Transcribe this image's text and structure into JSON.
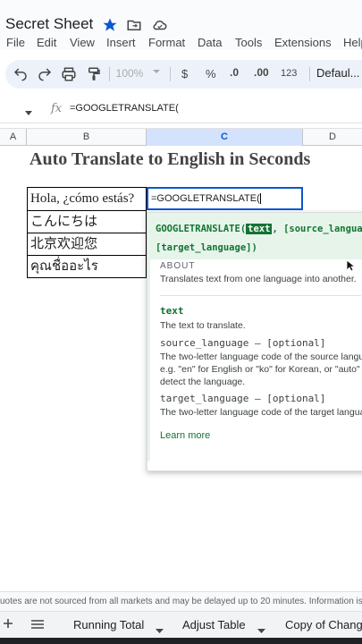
{
  "app": {
    "doc_title": "Secret Sheet",
    "menu": [
      "File",
      "Edit",
      "View",
      "Insert",
      "Format",
      "Data",
      "Tools",
      "Extensions",
      "Help"
    ]
  },
  "toolbar": {
    "zoom": "100%",
    "currency": "$",
    "percent": "%",
    "decrease_decimal": ".0",
    "increase_decimal": ".00",
    "number_format": "123",
    "font": "Defaul..."
  },
  "formula_bar": {
    "fx": "fx",
    "formula": "=GOOGLETRANSLATE("
  },
  "columns": [
    "A",
    "B",
    "C",
    "D"
  ],
  "sheet": {
    "heading": "Auto Translate to English in Seconds",
    "cells_b": [
      "Hola, ¿cómo estás?",
      "こんにちは",
      "北京欢迎您",
      "คุณชื่ออะไร"
    ],
    "active_cell_text": "=GOOGLETRANSLATE("
  },
  "popup": {
    "fn_name": "GOOGLETRANSLATE(",
    "param_text": "text",
    "sig_rest_1": ", [source_languag",
    "sig_line_2": "[target_language])",
    "about_label": "ABOUT",
    "about_text": "Translates text from one language into another.",
    "p1_name": "text",
    "p1_desc": "The text to translate.",
    "p2_name": "source_language – [optional]",
    "p2_desc_1": "The two-letter language code of the source langu",
    "p2_desc_2": "e.g. \"en\" for English or \"ko\" for Korean, or \"auto\" to",
    "p2_desc_3": "detect the language.",
    "p3_name": "target_language – [optional]",
    "p3_desc": "The two-letter language code of the target langua",
    "learn_more": "Learn more"
  },
  "banner": {
    "text": "uotes are not sourced from all markets and may be delayed up to 20 minutes. Information is p"
  },
  "tabs": [
    "Running Total",
    "Adjust Table",
    "Copy of Chang"
  ],
  "colors": {
    "accent": "#0b57d0",
    "formula_green": "#137333",
    "popup_bg": "#e6f4ea"
  }
}
